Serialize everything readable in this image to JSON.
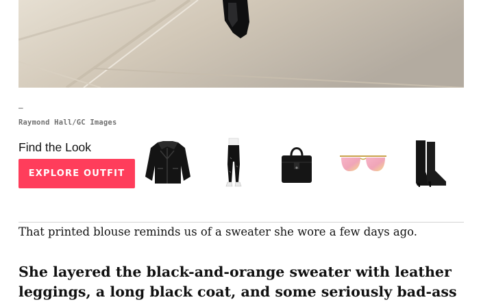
{
  "hero": {
    "alt": "street photo, black boot on sidewalk"
  },
  "caption": {
    "dash": "–",
    "credit": "Raymond Hall/GC Images"
  },
  "find_the_look": {
    "title": "Find the Look",
    "button_label": "EXPLORE OUTFIT",
    "button_color": "#ff3d5b",
    "products": [
      {
        "icon": "leather-jacket-icon"
      },
      {
        "icon": "leather-leggings-icon"
      },
      {
        "icon": "black-handbag-icon"
      },
      {
        "icon": "pink-sunglasses-icon"
      },
      {
        "icon": "black-boots-icon"
      }
    ]
  },
  "article": {
    "paragraph": "That printed blouse reminds us of a sweater she wore a few days ago.",
    "heading": "She layered the black-and-orange sweater with leather leggings, a long black coat, and some seriously bad-ass"
  }
}
